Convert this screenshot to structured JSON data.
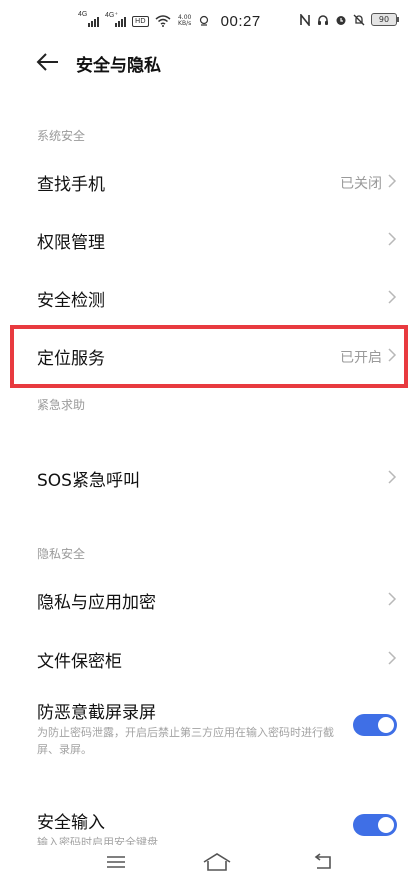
{
  "statusbar": {
    "sim1_label": "4G",
    "sim2_label": "4G⁺",
    "hd_label": "HD",
    "net_speed_value": "4.00",
    "net_speed_unit": "KB/s",
    "time": "00:27",
    "battery": "90",
    "icons": [
      "nfc-icon",
      "headset-icon",
      "alarm-icon",
      "mute-icon"
    ]
  },
  "header": {
    "back_icon": "back-arrow-icon",
    "title": "安全与隐私"
  },
  "sections": {
    "system_security": "系统安全",
    "emergency": "紧急求助",
    "privacy": "隐私安全"
  },
  "items": {
    "find_phone": {
      "label": "查找手机",
      "value": "已关闭"
    },
    "permissions": {
      "label": "权限管理"
    },
    "security_check": {
      "label": "安全检测"
    },
    "location": {
      "label": "定位服务",
      "value": "已开启"
    },
    "sos": {
      "label": "SOS紧急呼叫"
    },
    "privacy_encrypt": {
      "label": "隐私与应用加密"
    },
    "file_safe": {
      "label": "文件保密柜"
    },
    "anti_screenshot": {
      "label": "防恶意截屏录屏",
      "description": "为防止密码泄露，开启后禁止第三方应用在输入密码时进行截屏、录屏。",
      "enabled": true
    },
    "secure_input": {
      "label": "安全输入",
      "description": "输入密码时启用安全键盘",
      "enabled": true
    }
  },
  "highlight_color": "#e83a3f",
  "accent_color": "#3f6fe6",
  "navbar": {
    "icons": [
      "menu-icon",
      "home-icon",
      "back-icon"
    ]
  }
}
